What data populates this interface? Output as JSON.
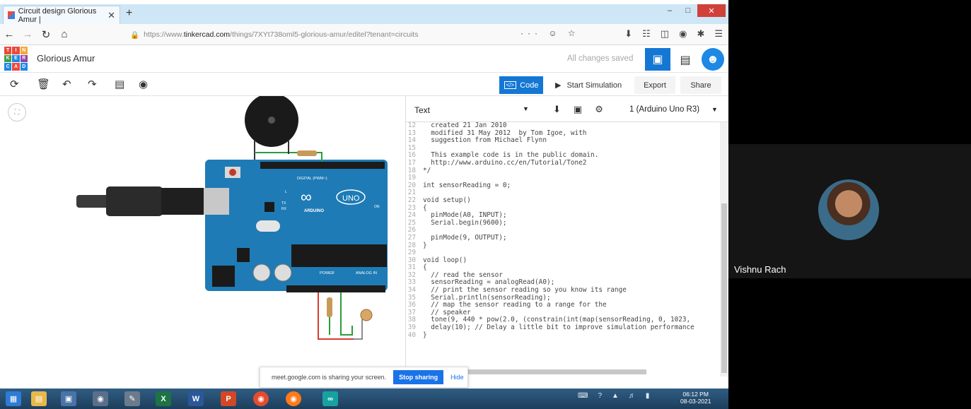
{
  "browser": {
    "tab_title": "Circuit design Glorious Amur |",
    "tab_close": "✕",
    "new_tab": "+",
    "url_prefix": "https://www.",
    "url_domain": "tinkercad.com",
    "url_path": "/things/7XYt738oml5-glorious-amur/editel?tenant=circuits",
    "url_more": "··· ☺ ☆"
  },
  "app": {
    "design_title": "Glorious Amur",
    "save_status": "All changes saved",
    "logo_letters": [
      "T",
      "I",
      "N",
      "K",
      "E",
      "R",
      "C",
      "A",
      "D"
    ],
    "logo_colors": [
      "#e94b3c",
      "#e94b3c",
      "#f3a93b",
      "#43a047",
      "#1e88e5",
      "#8e44ad",
      "#1e88e5",
      "#e94b3c",
      "#1e88e5"
    ]
  },
  "toolbar": {
    "code_label": "Code",
    "code_icon_text": "</>",
    "start_sim_label": "Start Simulation",
    "export_label": "Export",
    "share_label": "Share"
  },
  "code_editor": {
    "mode": "Text",
    "device": "1 (Arduino Uno R3)",
    "lines": [
      {
        "n": "12",
        "t": "  created 21 Jan 2010"
      },
      {
        "n": "13",
        "t": "  modified 31 May 2012  by Tom Igoe, with"
      },
      {
        "n": "14",
        "t": "  suggestion from Michael Flynn"
      },
      {
        "n": "15",
        "t": ""
      },
      {
        "n": "16",
        "t": "  This example code is in the public domain."
      },
      {
        "n": "17",
        "t": "  http://www.arduino.cc/en/Tutorial/Tone2"
      },
      {
        "n": "18",
        "t": "*/"
      },
      {
        "n": "19",
        "t": ""
      },
      {
        "n": "20",
        "t": "int sensorReading = 0;"
      },
      {
        "n": "21",
        "t": ""
      },
      {
        "n": "22",
        "t": "void setup()"
      },
      {
        "n": "23",
        "t": "{"
      },
      {
        "n": "24",
        "t": "  pinMode(A0, INPUT);"
      },
      {
        "n": "25",
        "t": "  Serial.begin(9600);"
      },
      {
        "n": "26",
        "t": ""
      },
      {
        "n": "27",
        "t": "  pinMode(9, OUTPUT);"
      },
      {
        "n": "28",
        "t": "}"
      },
      {
        "n": "29",
        "t": ""
      },
      {
        "n": "30",
        "t": "void loop()"
      },
      {
        "n": "31",
        "t": "{"
      },
      {
        "n": "32",
        "t": "  // read the sensor"
      },
      {
        "n": "33",
        "t": "  sensorReading = analogRead(A0);"
      },
      {
        "n": "34",
        "t": "  // print the sensor reading so you know its range"
      },
      {
        "n": "35",
        "t": "  Serial.println(sensorReading);"
      },
      {
        "n": "36",
        "t": "  // map the sensor reading to a range for the"
      },
      {
        "n": "37",
        "t": "  // speaker"
      },
      {
        "n": "38",
        "t": "  tone(9, 440 * pow(2.0, (constrain(int(map(sensorReading, 0, 1023,"
      },
      {
        "n": "39",
        "t": "  delay(10); // Delay a little bit to improve simulation performance"
      },
      {
        "n": "40",
        "t": "}"
      }
    ]
  },
  "board": {
    "brand": "ARDUINO",
    "model": "UNO",
    "digital_label": "DIGITAL (PWM~)",
    "power_label": "POWER",
    "analog_label": "ANALOG IN",
    "tx_label": "TX",
    "rx_label": "RX",
    "on_label": "ON",
    "l_label": "L"
  },
  "share_banner": {
    "text": "meet.google.com is sharing your screen.",
    "stop_label": "Stop sharing",
    "hide_label": "Hide"
  },
  "taskbar": {
    "clock_time": "06:12 PM",
    "clock_date": "08-03-2021"
  },
  "meet": {
    "participant_name": "Vishnu Rach"
  }
}
